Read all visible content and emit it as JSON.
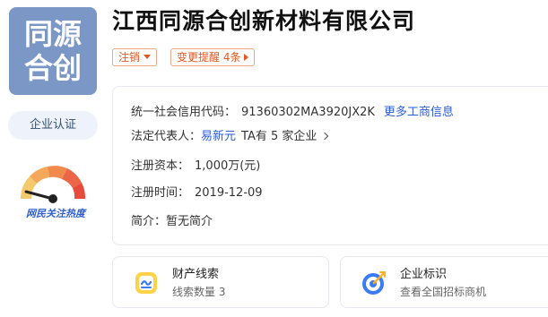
{
  "logo": {
    "line1": "同源",
    "line2": "合创"
  },
  "certification": {
    "label": "企业认证"
  },
  "heat": {
    "label": "网民关注热度"
  },
  "company": {
    "name": "江西同源合创新材料有限公司"
  },
  "tags": {
    "status": "注销",
    "change_reminder": "变更提醒 4条"
  },
  "info": {
    "credit_code_label": "统一社会信用代码：",
    "credit_code": "91360302MA3920JX2K",
    "more_link": "更多工商信息",
    "legal_rep_label": "法定代表人：",
    "legal_rep": "易新元",
    "legal_rep_companies": "TA有 5 家企业",
    "capital_label": "注册资本：",
    "capital": "1,000万(元)",
    "reg_date_label": "注册时间：",
    "reg_date": "2019-12-09",
    "intro_label": "简介：",
    "intro": "暂无简介"
  },
  "cards": [
    {
      "title": "财产线索",
      "subtitle": "线索数量 3",
      "icon": "property-clue-icon"
    },
    {
      "title": "企业标识",
      "subtitle": "查看全国招标商机",
      "icon": "target-icon"
    }
  ],
  "colors": {
    "logo_bg": "#7b97c6",
    "accent": "#e2561f",
    "link": "#2b5bd8"
  }
}
